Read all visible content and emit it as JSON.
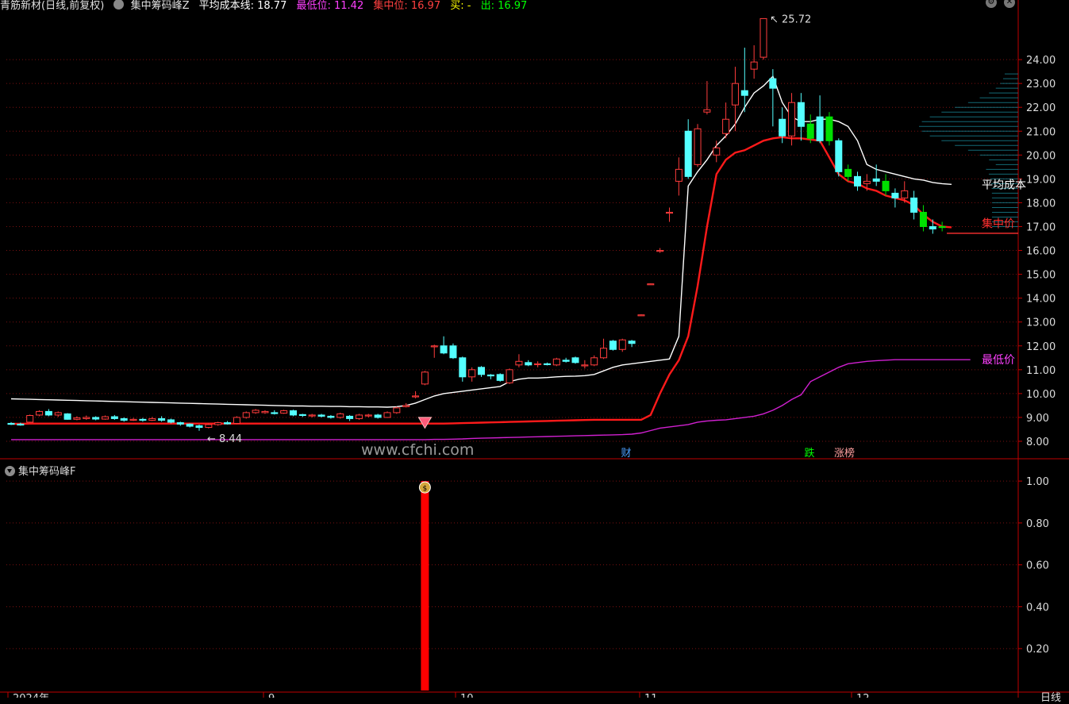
{
  "header": {
    "main_indicator": "青筋新材(日线,前复权)",
    "chip_indicator": "集中筹码峰Z",
    "avg_cost": "平均成本线: 18.77",
    "lowest": "最低位: 11.42",
    "concentrated": "集中位: 16.97",
    "buy": "买: -",
    "sell": "出: 16.97"
  },
  "colors": {
    "background": "#000000",
    "grid": "#7a1010",
    "axis": "#c00000",
    "up_candle": "#ff3c3c",
    "down_candle": "#54ffff",
    "green_candle": "#00e000",
    "avg_cost_line": "#ffffff",
    "concentrated_line": "#ff1a1a",
    "lowest_line": "#d020d0",
    "header_avg": "#ffffff",
    "header_lowest": "#ff40ff",
    "header_conc": "#ff4040",
    "header_buy": "#ffff00",
    "header_sell": "#00ff00"
  },
  "chart_data": [
    {
      "type": "candlestick",
      "y_axis_ticks": [
        "24.00",
        "23.00",
        "22.00",
        "21.00",
        "20.00",
        "19.00",
        "18.00",
        "17.00",
        "16.00",
        "15.00",
        "14.00",
        "13.00",
        "12.00",
        "11.00",
        "10.00",
        "9.00",
        "8.00"
      ],
      "ylim": [
        7.6,
        25.9
      ],
      "max_label": "25.72",
      "min_label": "8.44",
      "line_labels": {
        "avg": "平均成本",
        "conc": "集中价",
        "low": "最低价"
      },
      "event_tags": [
        {
          "text": "财",
          "color": "#4a9fff"
        },
        {
          "text": "跌",
          "color": "#00ff00"
        },
        {
          "text": "涨榜",
          "color": "#ffa0a0"
        }
      ],
      "x_labels": [
        "2024年",
        "9",
        "10",
        "11",
        "12"
      ],
      "candles": [
        [
          8.75,
          8.72,
          8.8,
          8.68
        ],
        [
          8.72,
          8.7,
          8.78,
          8.65
        ],
        [
          8.8,
          9.08,
          9.12,
          8.78
        ],
        [
          9.1,
          9.25,
          9.3,
          9.05
        ],
        [
          9.25,
          9.1,
          9.35,
          9.05
        ],
        [
          9.1,
          9.2,
          9.25,
          9.02
        ],
        [
          9.15,
          8.92,
          9.18,
          8.9
        ],
        [
          8.92,
          8.98,
          9.05,
          8.88
        ],
        [
          8.95,
          9.0,
          9.08,
          8.9
        ],
        [
          9.0,
          8.93,
          9.05,
          8.88
        ],
        [
          8.93,
          9.03,
          9.08,
          8.9
        ],
        [
          9.03,
          8.95,
          9.1,
          8.9
        ],
        [
          8.95,
          8.88,
          9.0,
          8.82
        ],
        [
          8.88,
          8.92,
          8.98,
          8.85
        ],
        [
          8.92,
          8.88,
          8.98,
          8.82
        ],
        [
          8.88,
          8.95,
          9.02,
          8.85
        ],
        [
          8.95,
          8.88,
          9.05,
          8.82
        ],
        [
          8.9,
          8.8,
          8.95,
          8.75
        ],
        [
          8.78,
          8.72,
          8.82,
          8.65
        ],
        [
          8.72,
          8.63,
          8.75,
          8.58
        ],
        [
          8.65,
          8.58,
          8.7,
          8.44
        ],
        [
          8.58,
          8.7,
          8.75,
          8.54
        ],
        [
          8.7,
          8.78,
          8.82,
          8.65
        ],
        [
          8.78,
          8.73,
          8.85,
          8.7
        ],
        [
          8.75,
          9.0,
          9.05,
          8.72
        ],
        [
          9.0,
          9.2,
          9.25,
          8.95
        ],
        [
          9.2,
          9.3,
          9.35,
          9.15
        ],
        [
          9.2,
          9.25,
          9.3,
          9.15
        ],
        [
          9.2,
          9.18,
          9.3,
          9.12
        ],
        [
          9.18,
          9.28,
          9.32,
          9.15
        ],
        [
          9.28,
          9.1,
          9.32,
          9.05
        ],
        [
          9.12,
          9.08,
          9.15,
          9.02
        ],
        [
          9.08,
          9.1,
          9.15,
          9.0
        ],
        [
          9.1,
          9.05,
          9.15,
          9.0
        ],
        [
          9.05,
          9.0,
          9.1,
          8.95
        ],
        [
          9.0,
          9.15,
          9.2,
          8.95
        ],
        [
          9.05,
          8.95,
          9.1,
          8.85
        ],
        [
          8.95,
          9.1,
          9.15,
          8.9
        ],
        [
          9.08,
          9.1,
          9.15,
          9.0
        ],
        [
          9.1,
          9.0,
          9.15,
          8.95
        ],
        [
          9.0,
          9.2,
          9.25,
          8.98
        ],
        [
          9.2,
          9.4,
          9.45,
          9.15
        ],
        [
          9.45,
          9.5,
          9.6,
          9.42
        ],
        [
          9.9,
          9.9,
          10.1,
          9.8
        ],
        [
          10.4,
          10.9,
          10.95,
          10.35
        ],
        [
          12.0,
          12.0,
          12.05,
          11.5
        ],
        [
          12.0,
          11.7,
          12.4,
          11.65
        ],
        [
          12.0,
          11.5,
          12.1,
          11.45
        ],
        [
          11.5,
          10.7,
          11.55,
          10.5
        ],
        [
          10.7,
          11.0,
          11.1,
          10.5
        ],
        [
          11.1,
          10.8,
          11.15,
          10.7
        ],
        [
          10.78,
          10.75,
          10.82,
          10.6
        ],
        [
          10.8,
          10.55,
          10.85,
          10.5
        ],
        [
          10.45,
          11.0,
          11.05,
          10.4
        ],
        [
          11.2,
          11.35,
          11.65,
          11.1
        ],
        [
          11.3,
          11.2,
          11.4,
          11.15
        ],
        [
          11.25,
          11.25,
          11.35,
          11.1
        ],
        [
          11.25,
          11.22,
          11.3,
          11.18
        ],
        [
          11.2,
          11.45,
          11.5,
          11.15
        ],
        [
          11.4,
          11.35,
          11.5,
          11.3
        ],
        [
          11.5,
          11.3,
          11.55,
          11.25
        ],
        [
          11.2,
          11.2,
          11.4,
          11.05
        ],
        [
          11.2,
          11.5,
          11.6,
          11.15
        ],
        [
          11.5,
          11.9,
          12.3,
          11.45
        ],
        [
          12.2,
          11.85,
          12.25,
          11.8
        ],
        [
          11.85,
          12.25,
          12.3,
          11.75
        ],
        [
          12.2,
          12.1,
          12.25,
          11.95
        ],
        [
          13.3,
          13.3,
          13.32,
          13.28
        ],
        [
          14.6,
          14.6,
          14.62,
          14.58
        ],
        [
          16.0,
          16.0,
          16.1,
          15.9
        ],
        [
          17.6,
          17.6,
          17.8,
          17.2
        ],
        [
          18.9,
          19.4,
          19.9,
          18.3
        ],
        [
          21.0,
          19.1,
          21.5,
          19.0
        ],
        [
          19.6,
          21.1,
          21.3,
          19.5
        ],
        [
          21.8,
          21.9,
          23.1,
          21.7
        ],
        [
          20.0,
          20.3,
          20.6,
          19.7
        ],
        [
          20.9,
          21.5,
          22.2,
          20.7
        ],
        [
          22.1,
          23.0,
          23.7,
          21.0
        ],
        [
          22.7,
          22.5,
          24.5,
          21.8
        ],
        [
          23.6,
          23.9,
          24.6,
          23.2
        ],
        [
          24.1,
          25.72,
          25.72,
          24.0
        ],
        [
          23.2,
          22.8,
          23.6,
          21.2
        ],
        [
          21.5,
          20.8,
          22.0,
          20.5
        ],
        [
          20.8,
          22.2,
          22.6,
          20.4
        ],
        [
          22.2,
          21.2,
          22.6,
          20.6
        ],
        [
          21.3,
          20.7,
          21.7,
          20.5
        ],
        [
          21.6,
          20.6,
          22.5,
          20.5
        ],
        [
          21.6,
          20.6,
          21.8,
          20.4
        ],
        [
          20.6,
          19.3,
          20.7,
          19.1
        ],
        [
          19.4,
          19.1,
          19.6,
          18.9
        ],
        [
          19.1,
          18.7,
          19.3,
          18.5
        ],
        [
          18.8,
          18.9,
          19.2,
          18.5
        ],
        [
          19.0,
          18.9,
          19.6,
          18.7
        ],
        [
          18.9,
          18.5,
          19.2,
          18.3
        ],
        [
          18.4,
          18.2,
          18.6,
          17.8
        ],
        [
          18.2,
          18.5,
          18.9,
          18.0
        ],
        [
          18.2,
          17.6,
          18.5,
          17.3
        ],
        [
          17.6,
          17.0,
          17.9,
          16.8
        ],
        [
          17.0,
          16.9,
          17.3,
          16.7
        ],
        [
          17.0,
          16.97,
          17.2,
          16.8
        ]
      ],
      "avg_cost_line": [
        9.78,
        9.77,
        9.76,
        9.75,
        9.74,
        9.73,
        9.72,
        9.71,
        9.7,
        9.69,
        9.68,
        9.67,
        9.66,
        9.65,
        9.64,
        9.63,
        9.62,
        9.61,
        9.6,
        9.59,
        9.58,
        9.57,
        9.56,
        9.55,
        9.54,
        9.53,
        9.52,
        9.51,
        9.5,
        9.49,
        9.48,
        9.48,
        9.47,
        9.47,
        9.46,
        9.46,
        9.45,
        9.45,
        9.44,
        9.44,
        9.43,
        9.45,
        9.5,
        9.6,
        9.75,
        9.9,
        10.0,
        10.05,
        10.1,
        10.15,
        10.2,
        10.25,
        10.3,
        10.5,
        10.6,
        10.65,
        10.65,
        10.67,
        10.7,
        10.72,
        10.73,
        10.75,
        10.8,
        10.95,
        11.1,
        11.2,
        11.25,
        11.3,
        11.35,
        11.4,
        11.45,
        12.4,
        18.7,
        19.3,
        19.8,
        20.4,
        20.8,
        21.3,
        22.0,
        22.6,
        22.9,
        23.3,
        22.2,
        21.6,
        21.4,
        21.4,
        21.5,
        21.5,
        21.4,
        21.2,
        20.6,
        19.6,
        19.4,
        19.3,
        19.2,
        19.1,
        19.0,
        18.95,
        18.85,
        18.8,
        18.77
      ],
      "conc_line": [
        8.73,
        8.73,
        8.74,
        8.74,
        8.74,
        8.74,
        8.74,
        8.74,
        8.74,
        8.74,
        8.74,
        8.74,
        8.74,
        8.74,
        8.74,
        8.74,
        8.74,
        8.74,
        8.74,
        8.74,
        8.74,
        8.74,
        8.74,
        8.74,
        8.74,
        8.74,
        8.74,
        8.74,
        8.74,
        8.74,
        8.74,
        8.74,
        8.74,
        8.74,
        8.74,
        8.74,
        8.74,
        8.74,
        8.74,
        8.74,
        8.74,
        8.74,
        8.74,
        8.74,
        8.74,
        8.74,
        8.74,
        8.75,
        8.76,
        8.77,
        8.78,
        8.79,
        8.8,
        8.81,
        8.82,
        8.83,
        8.84,
        8.85,
        8.86,
        8.87,
        8.88,
        8.89,
        8.9,
        8.9,
        8.9,
        8.9,
        8.9,
        8.9,
        9.1,
        10.0,
        10.8,
        11.4,
        12.4,
        14.5,
        17.0,
        19.2,
        19.8,
        20.1,
        20.2,
        20.4,
        20.6,
        20.7,
        20.75,
        20.7,
        20.7,
        20.65,
        20.6,
        19.9,
        19.2,
        18.9,
        18.8,
        18.6,
        18.5,
        18.3,
        18.2,
        18.1,
        17.9,
        17.5,
        17.2,
        17.0,
        16.97
      ],
      "low_line": [
        8.07,
        8.07,
        8.07,
        8.07,
        8.07,
        8.07,
        8.07,
        8.07,
        8.07,
        8.07,
        8.07,
        8.07,
        8.07,
        8.07,
        8.07,
        8.07,
        8.07,
        8.07,
        8.07,
        8.07,
        8.07,
        8.07,
        8.07,
        8.07,
        8.07,
        8.07,
        8.07,
        8.07,
        8.07,
        8.07,
        8.07,
        8.07,
        8.07,
        8.07,
        8.07,
        8.07,
        8.07,
        8.07,
        8.07,
        8.07,
        8.07,
        8.07,
        8.07,
        8.07,
        8.07,
        8.08,
        8.08,
        8.09,
        8.1,
        8.12,
        8.13,
        8.14,
        8.15,
        8.16,
        8.17,
        8.18,
        8.19,
        8.2,
        8.21,
        8.22,
        8.23,
        8.24,
        8.25,
        8.26,
        8.27,
        8.28,
        8.3,
        8.35,
        8.45,
        8.55,
        8.6,
        8.65,
        8.7,
        8.8,
        8.85,
        8.88,
        8.9,
        8.95,
        9.0,
        9.05,
        9.15,
        9.3,
        9.5,
        9.75,
        9.95,
        10.5,
        10.7,
        10.9,
        11.1,
        11.25,
        11.3,
        11.35,
        11.38,
        11.4,
        11.42,
        11.42,
        11.42,
        11.42,
        11.42,
        11.42,
        11.42,
        11.42,
        11.42
      ]
    },
    {
      "type": "bar",
      "title": "集中筹码峰F",
      "y_axis_ticks": [
        "1.00",
        "0.80",
        "0.60",
        "0.40",
        "0.20"
      ],
      "ylim": [
        0,
        1.08
      ],
      "signal_index": 44,
      "signal_value": 1.0
    }
  ],
  "period_label": "日线"
}
